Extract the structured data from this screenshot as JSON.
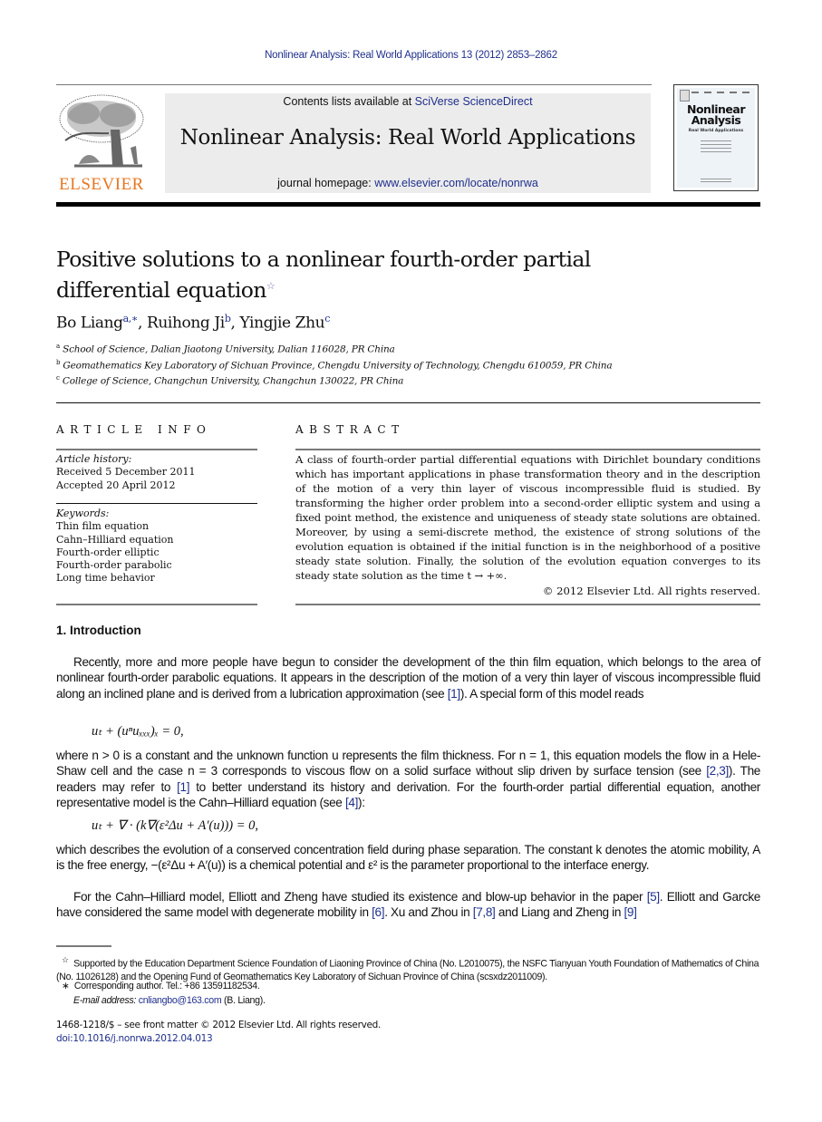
{
  "running_head": "Nonlinear Analysis: Real World Applications 13 (2012) 2853–2862",
  "masthead": {
    "publisher_logo_text": "ELSEVIER",
    "contents_prefix": "Contents lists available at ",
    "contents_link": "SciVerse ScienceDirect",
    "journal_title": "Nonlinear Analysis: Real World Applications",
    "homepage_prefix": "journal homepage: ",
    "homepage_link": "www.elsevier.com/locate/nonrwa",
    "cover_title_line1": "Nonlinear",
    "cover_title_line2": "Analysis",
    "cover_subtitle": "Real World Applications"
  },
  "article": {
    "title_line1": "Positive solutions to a nonlinear fourth-order partial",
    "title_line2": "differential equation",
    "title_mark": "☆",
    "authors": [
      {
        "name": "Bo Liang",
        "sup": "a,∗"
      },
      {
        "name": "Ruihong Ji",
        "sup": "b"
      },
      {
        "name": "Yingjie Zhu",
        "sup": "c"
      }
    ],
    "affiliations": [
      {
        "mark": "a",
        "text": "School of Science, Dalian Jiaotong University, Dalian 116028, PR China"
      },
      {
        "mark": "b",
        "text": "Geomathematics Key Laboratory of Sichuan Province, Chengdu University of Technology, Chengdu 610059, PR China"
      },
      {
        "mark": "c",
        "text": "College of Science, Changchun University, Changchun 130022, PR China"
      }
    ]
  },
  "article_info": {
    "heading": "ARTICLE INFO",
    "history_label": "Article history:",
    "received": "Received 5 December 2011",
    "accepted": "Accepted 20 April 2012",
    "keywords_label": "Keywords:",
    "keywords": [
      "Thin film equation",
      "Cahn–Hilliard equation",
      "Fourth-order elliptic",
      "Fourth-order parabolic",
      "Long time behavior"
    ]
  },
  "abstract": {
    "heading": "ABSTRACT",
    "text": "A class of fourth-order partial differential equations with Dirichlet boundary conditions which has important applications in phase transformation theory and in the description of the motion of a very thin layer of viscous incompressible fluid is studied. By transforming the higher order problem into a second-order elliptic system and using a fixed point method, the existence and uniqueness of steady state solutions are obtained. Moreover, by using a semi-discrete method, the existence of strong solutions of the evolution equation is obtained if the initial function is in the neighborhood of a positive steady state solution. Finally, the solution of the evolution equation converges to its steady state solution as the time t → +∞.",
    "copyright": "© 2012 Elsevier Ltd. All rights reserved."
  },
  "introduction": {
    "heading": "1.  Introduction",
    "p1_a": "Recently, more and more people have begun to consider the development of the thin film equation, which belongs to the area of nonlinear fourth-order parabolic equations. It appears in the description of the motion of a very thin layer of viscous incompressible fluid along an inclined plane and is derived from a lubrication approximation (see ",
    "p1_ref": "[1]",
    "p1_b": "). A special form of this model reads",
    "eq1": "uₜ + (uⁿuₓₓₓ)ₓ = 0,",
    "p2_a": "where n > 0 is a constant and the unknown function u represents the film thickness. For n = 1, this equation models the flow in a Hele-Shaw cell and the case n = 3 corresponds to viscous flow on a solid surface without slip driven by surface tension (see ",
    "p2_ref1": "[2,3]",
    "p2_b": "). The readers may refer to ",
    "p2_ref2": "[1]",
    "p2_c": " to better understand its history and derivation. For the fourth-order partial differential equation, another representative model is the Cahn–Hilliard equation (see ",
    "p2_ref3": "[4]",
    "p2_d": "):",
    "eq2": "uₜ + ∇ · (k∇(ε²Δu + A′(u))) = 0,",
    "p3": "which describes the evolution of a conserved concentration field during phase separation. The constant k denotes the atomic mobility, A is the free energy, −(ε²Δu + A′(u)) is a chemical potential and ε² is the parameter proportional to the interface energy.",
    "p4_a": "For the Cahn–Hilliard model, Elliott and Zheng have studied its existence and blow-up behavior in the paper ",
    "p4_ref1": "[5]",
    "p4_b": ". Elliott and Garcke have considered the same model with degenerate mobility in ",
    "p4_ref2": "[6]",
    "p4_c": ". Xu and Zhou in ",
    "p4_ref3": "[7,8]",
    "p4_d": " and Liang and Zheng in ",
    "p4_ref4": "[9]"
  },
  "footnotes": {
    "funding_mark": "☆",
    "funding": "Supported by the Education Department Science Foundation of Liaoning Province of China (No. L2010075), the NSFC Tianyuan Youth Foundation of Mathematics of China (No. 11026128) and the Opening Fund of Geomathematics Key Laboratory of Sichuan Province of China (scsxdz2011009).",
    "corresponding_mark": "∗",
    "corresponding": "Corresponding author. Tel.: +86 13591182534.",
    "email_label": "E-mail address: ",
    "email": "cnliangbo@163.com",
    "email_suffix": " (B. Liang)."
  },
  "front_matter": {
    "issn_line": "1468-1218/$ – see front matter © 2012 Elsevier Ltd. All rights reserved.",
    "doi": "doi:10.1016/j.nonrwa.2012.04.013"
  }
}
